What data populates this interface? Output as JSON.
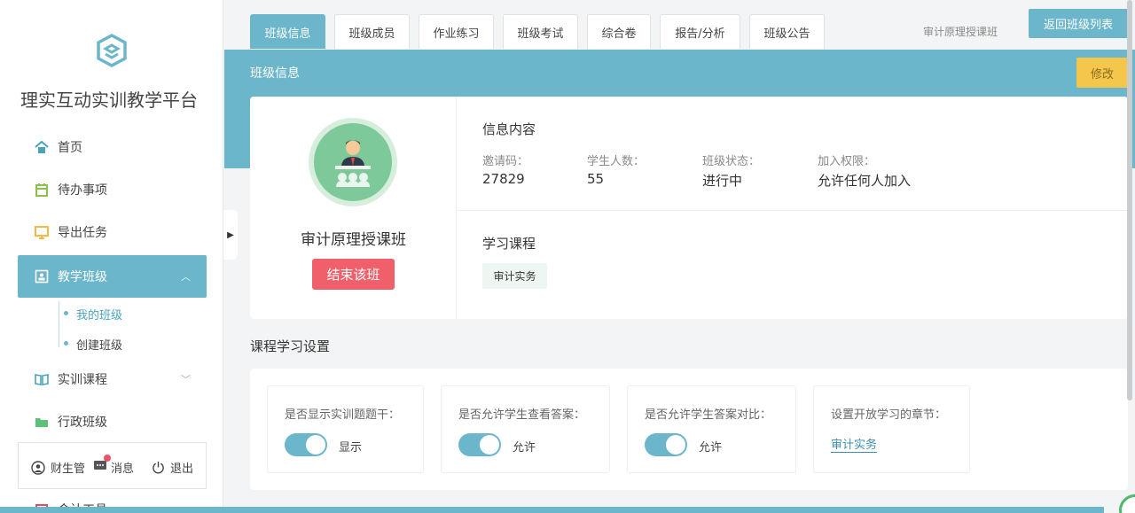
{
  "brand": {
    "title": "理实互动实训教学平台"
  },
  "sidebar": {
    "items": [
      {
        "label": "首页",
        "icon": "home-icon"
      },
      {
        "label": "待办事项",
        "icon": "calendar-icon"
      },
      {
        "label": "导出任务",
        "icon": "monitor-icon"
      },
      {
        "label": "教学班级",
        "icon": "class-icon",
        "active": true
      },
      {
        "label": "实训课程",
        "icon": "book-icon"
      },
      {
        "label": "行政班级",
        "icon": "folder-icon"
      },
      {
        "label": "会计工具",
        "icon": "tool-icon"
      }
    ],
    "subitems": [
      {
        "label": "我的班级"
      },
      {
        "label": "创建班级"
      }
    ],
    "user": {
      "name": "财生管",
      "messages": "消息",
      "logout": "退出"
    }
  },
  "tabs": [
    {
      "label": "班级信息"
    },
    {
      "label": "班级成员"
    },
    {
      "label": "作业练习"
    },
    {
      "label": "班级考试"
    },
    {
      "label": "综合卷"
    },
    {
      "label": "报告/分析"
    },
    {
      "label": "班级公告"
    }
  ],
  "top": {
    "class_name": "审计原理授课班",
    "back_label": "返回班级列表"
  },
  "panel": {
    "title": "班级信息",
    "edit_label": "修改"
  },
  "card": {
    "class_name": "审计原理授课班",
    "end_label": "结束该班",
    "info_title": "信息内容",
    "fields": [
      {
        "label": "邀请码：",
        "value": "27829"
      },
      {
        "label": "学生人数：",
        "value": "55"
      },
      {
        "label": "班级状态：",
        "value": "进行中"
      },
      {
        "label": "加入权限：",
        "value": "允许任何人加入"
      }
    ],
    "course_title": "学习课程",
    "course_tag": "审计实务"
  },
  "settings": {
    "title": "课程学习设置",
    "items": [
      {
        "label": "是否显示实训题题干：",
        "value": "显示"
      },
      {
        "label": "是否允许学生查看答案：",
        "value": "允许"
      },
      {
        "label": "是否允许学生答案对比：",
        "value": "允许"
      },
      {
        "label": "设置开放学习的章节：",
        "value": "审计实务"
      }
    ]
  },
  "colors": {
    "accent": "#6bb6cb",
    "warn": "#f4c64c",
    "danger": "#f0606a"
  }
}
